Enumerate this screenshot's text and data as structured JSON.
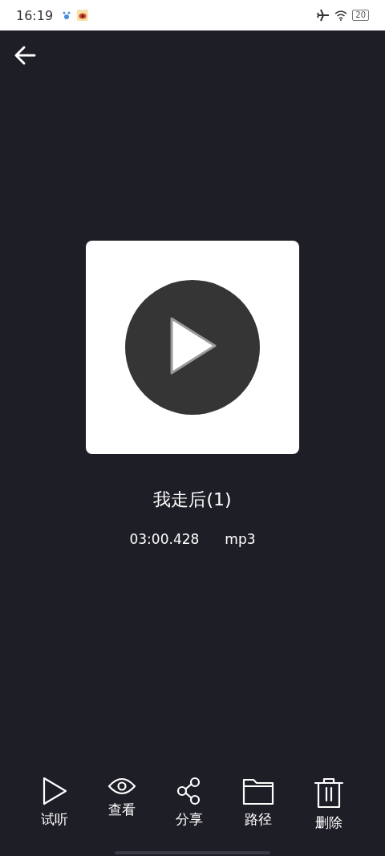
{
  "status_bar": {
    "time": "16:19",
    "battery": "20"
  },
  "track": {
    "title": "我走后(1)",
    "duration": "03:00.428",
    "format": "mp3"
  },
  "actions": [
    {
      "kind": "play",
      "label": "试听"
    },
    {
      "kind": "view",
      "label": "查看"
    },
    {
      "kind": "share",
      "label": "分享"
    },
    {
      "kind": "folder",
      "label": "路径"
    },
    {
      "kind": "delete",
      "label": "删除"
    }
  ]
}
